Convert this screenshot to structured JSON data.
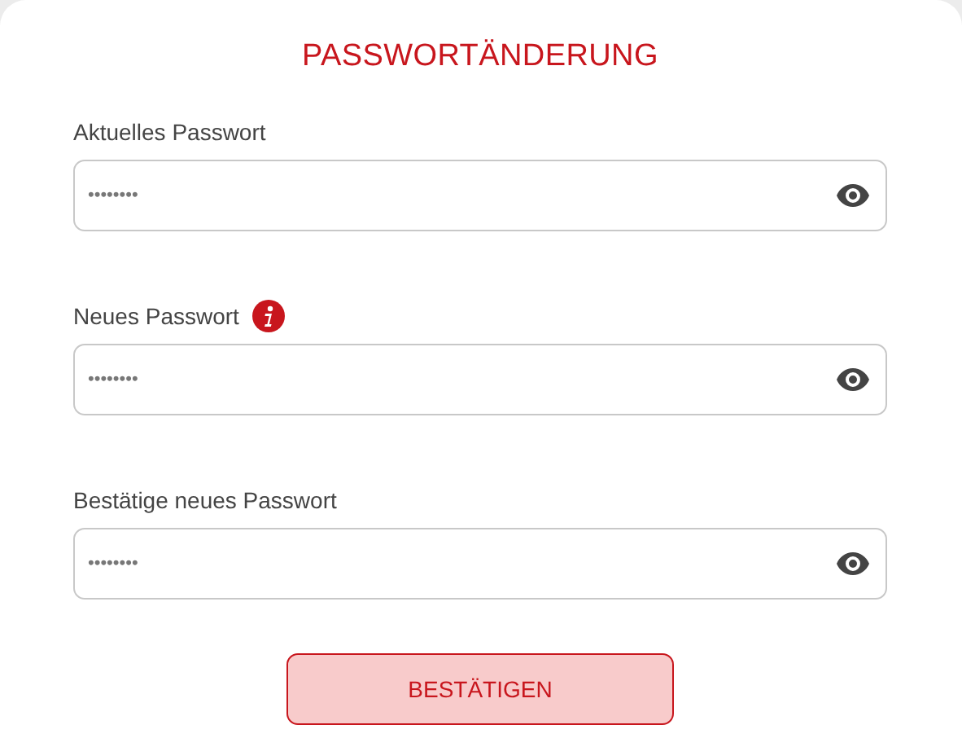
{
  "title": "PASSWORTÄNDERUNG",
  "fields": [
    {
      "label": "Aktuelles Passwort",
      "info": false,
      "value": "••••••••"
    },
    {
      "label": "Neues Passwort",
      "info": true,
      "value": "••••••••"
    },
    {
      "label": "Bestätige neues Passwort",
      "info": false,
      "value": "••••••••"
    }
  ],
  "button": "BESTÄTIGEN"
}
